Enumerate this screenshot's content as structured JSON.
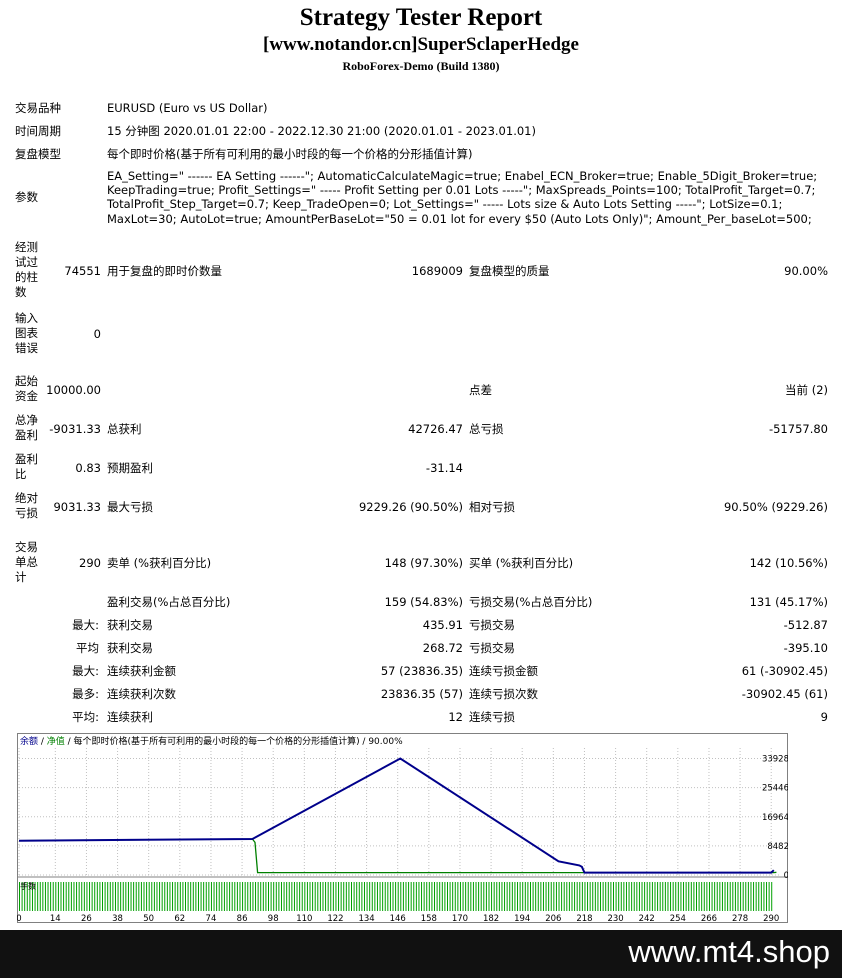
{
  "header": {
    "title": "Strategy Tester Report",
    "subtitle": "[www.notandor.cn]SuperSclaperHedge",
    "server": "RoboForex-Demo (Build 1380)"
  },
  "info": {
    "symbol_label": "交易品种",
    "symbol": "EURUSD (Euro vs US Dollar)",
    "period_label": "时间周期",
    "period": "15 分钟图 2020.01.01 22:00 - 2022.12.30 21:00 (2020.01.01 - 2023.01.01)",
    "model_label": "复盘模型",
    "model": "每个即时价格(基于所有可利用的最小时段的每一个价格的分形插值计算)",
    "params_label": "参数",
    "params": "EA_Setting=\" ------ EA Setting ------\"; AutomaticCalculateMagic=true; Enabel_ECN_Broker=true; Enable_5Digit_Broker=true; KeepTrading=true; Profit_Settings=\" ----- Profit Setting per 0.01 Lots -----\"; MaxSpreads_Points=100; TotalProfit_Target=0.7; TotalProfit_Step_Target=0.7; Keep_TradeOpen=0; Lot_Settings=\" ----- Lots size & Auto Lots Setting -----\"; LotSize=0.1; MaxLot=30; AutoLot=true; AmountPerBaseLot=\"50 = 0.01 lot for every $50 (Auto Lots Only)\"; Amount_Per_baseLot=500;"
  },
  "stats": {
    "bars_label": "经测试过的柱数",
    "bars": "74551",
    "ticks_label": "用于复盘的即时价数量",
    "ticks": "1689009",
    "quality_label": "复盘模型的质量",
    "quality": "90.00%",
    "errors_label": "输入图表错误",
    "errors": "0",
    "deposit_label": "起始资金",
    "deposit": "10000.00",
    "spread_label": "点差",
    "spread": "当前 (2)",
    "net_label": "总净盈利",
    "net": "-9031.33",
    "gross_profit_label": "总获利",
    "gross_profit": "42726.47",
    "gross_loss_label": "总亏损",
    "gross_loss": "-51757.80",
    "pf_label": "盈利比",
    "pf": "0.83",
    "expected_label": "预期盈利",
    "expected": "-31.14",
    "abs_dd_label": "绝对亏损",
    "abs_dd": "9031.33",
    "max_dd_label": "最大亏损",
    "max_dd": "9229.26 (90.50%)",
    "rel_dd_label": "相对亏损",
    "rel_dd": "90.50% (9229.26)",
    "trades_label": "交易单总计",
    "trades": "290",
    "short_label": "卖单 (%获利百分比)",
    "short": "148 (97.30%)",
    "long_label": "买单 (%获利百分比)",
    "long": "142 (10.56%)",
    "profit_trades_label": "盈利交易(%占总百分比)",
    "profit_trades": "159 (54.83%)",
    "loss_trades_label": "亏损交易(%占总百分比)",
    "loss_trades": "131 (45.17%)",
    "max_prefix": "最大:",
    "avg_prefix": "平均",
    "max2_prefix": "最大:",
    "most_prefix": "最多:",
    "avg2_prefix": "平均:",
    "largest_profit_label": "获利交易",
    "largest_profit": "435.91",
    "largest_loss_label": "亏损交易",
    "largest_loss": "-512.87",
    "avg_profit_label": "获利交易",
    "avg_profit": "268.72",
    "avg_loss_label": "亏损交易",
    "avg_loss": "-395.10",
    "max_cons_wins_label": "连续获利金额",
    "max_cons_wins": "57 (23836.35)",
    "max_cons_losses_label": "连续亏损金额",
    "max_cons_losses": "61 (-30902.45)",
    "max_cons_profit_label": "连续获利次数",
    "max_cons_profit": "23836.35 (57)",
    "max_cons_loss_label": "连续亏损次数",
    "max_cons_loss": "-30902.45 (61)",
    "avg_cons_wins_label": "连续获利",
    "avg_cons_wins": "12",
    "avg_cons_losses_label": "连续亏损",
    "avg_cons_losses": "9"
  },
  "chart_data": {
    "type": "line",
    "legend": {
      "balance": "余额",
      "sep1": " / ",
      "equity": "净值",
      "rest": " / 每个即时价格(基于所有可利用的最小时段的每一个价格的分形插值计算) / 90.00%"
    },
    "colors": {
      "balance": "#00008b",
      "equity": "#008000",
      "lot": "#00a000",
      "grid": "#c0c0c0"
    },
    "ylim": [
      0,
      37000
    ],
    "y_ticks": [
      0,
      8482,
      16964,
      25446,
      33928
    ],
    "x_ticks": [
      0,
      14,
      26,
      38,
      50,
      62,
      74,
      86,
      98,
      110,
      122,
      134,
      146,
      158,
      170,
      182,
      194,
      206,
      218,
      230,
      242,
      254,
      266,
      278,
      290
    ],
    "x_max": 293,
    "lot_label": "手数",
    "series": [
      {
        "name": "余额",
        "x": [
          0,
          90,
          147,
          208,
          216,
          217,
          218,
          290,
          291
        ],
        "values": [
          10000,
          10500,
          33928,
          4000,
          2800,
          2400,
          700,
          700,
          1400
        ]
      },
      {
        "name": "净值",
        "x": [
          0,
          90,
          91,
          92,
          291,
          292
        ],
        "values": [
          10000,
          10500,
          9500,
          700,
          700,
          800
        ]
      }
    ]
  },
  "footer": {
    "watermark": "www.mt4.shop"
  }
}
